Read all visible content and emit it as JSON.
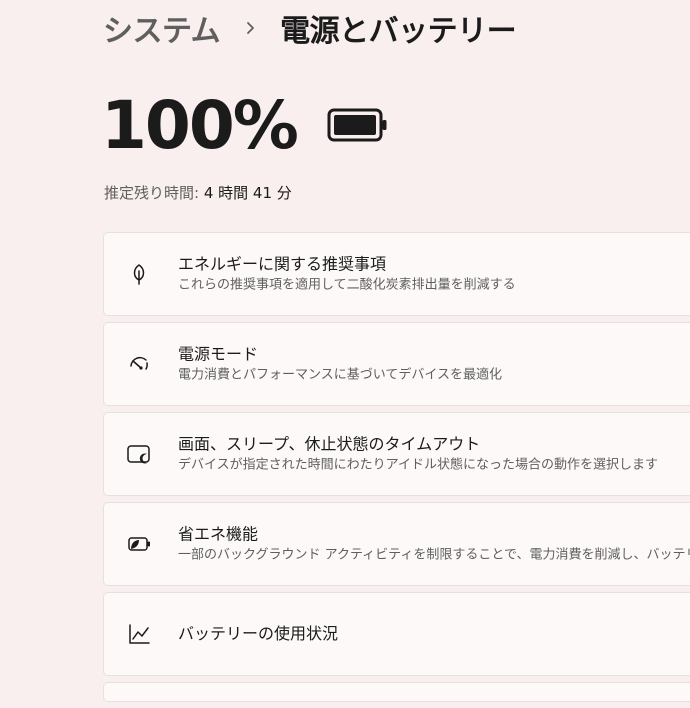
{
  "header": {
    "parent": "システム",
    "current": "電源とバッテリー"
  },
  "battery": {
    "percent": "100%",
    "estimate_label": "推定残り時間: ",
    "estimate_value": "4 時間 41 分"
  },
  "cards": [
    {
      "icon": "leaf-icon",
      "title": "エネルギーに関する推奨事項",
      "subtitle": "これらの推奨事項を適用して二酸化炭素排出量を削減する"
    },
    {
      "icon": "gauge-icon",
      "title": "電源モード",
      "subtitle": "電力消費とパフォーマンスに基づいてデバイスを最適化"
    },
    {
      "icon": "screen-sleep-icon",
      "title": "画面、スリープ、休止状態のタイムアウト",
      "subtitle": "デバイスが指定された時間にわたりアイドル状態になった場合の動作を選択します"
    },
    {
      "icon": "battery-saver-icon",
      "title": "省エネ機能",
      "subtitle": "一部のバックグラウンド アクティビティを制限することで、電力消費を削減し、バッテリーの寿"
    },
    {
      "icon": "chart-icon",
      "title": "バッテリーの使用状況",
      "subtitle": ""
    }
  ],
  "colors": {
    "background": "#f8efee",
    "card": "#fcf9f8",
    "text_primary": "#1b1b1b",
    "text_secondary": "#5f5f5f"
  }
}
